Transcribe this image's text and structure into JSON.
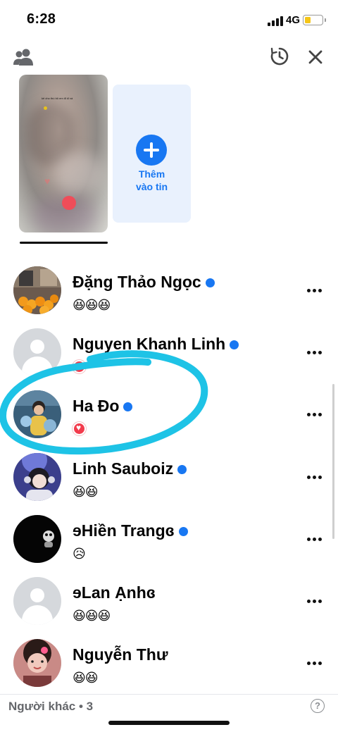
{
  "status_bar": {
    "time": "6:28",
    "network": "4G",
    "battery_level": 0.35
  },
  "header": {
    "left_icon": "friends-icon",
    "right_icons": [
      "history-icon",
      "close-icon"
    ]
  },
  "story": {
    "add_card_label_line1": "Thêm",
    "add_card_label_line2": "vào tin",
    "caption": "kẻ cho thú bỏ em đi kỉ vá"
  },
  "viewers": [
    {
      "name": "Đặng Thảo Ngọc",
      "online": true,
      "reaction": "😆😆😆",
      "reaction_type": "haha",
      "avatar": "photo-oranges"
    },
    {
      "name": "Nguyen Khanh Linh",
      "online": true,
      "reaction": "",
      "reaction_type": "love",
      "avatar": "default"
    },
    {
      "name": "Ha Đo",
      "online": true,
      "reaction": "",
      "reaction_type": "love",
      "avatar": "photo-child"
    },
    {
      "name": "Linh Sauboiz",
      "online": true,
      "reaction": "😆😆",
      "reaction_type": "haha",
      "avatar": "photo-girl-headphones"
    },
    {
      "name": "ɘHiền Trangɞ",
      "online": true,
      "reaction": "😥",
      "reaction_type": "sad",
      "avatar": "photo-dark"
    },
    {
      "name": "ɘLan Ạnhɞ",
      "online": false,
      "reaction": "😆😆😆",
      "reaction_type": "haha",
      "avatar": "default"
    },
    {
      "name": "Nguyễn Thư",
      "online": false,
      "reaction": "😆😆",
      "reaction_type": "haha",
      "avatar": "photo-girl-pink"
    }
  ],
  "footer": {
    "label": "Người khác • 3",
    "help": "?"
  },
  "colors": {
    "accent": "#1877f2",
    "annotation": "#1ec3e6",
    "heart": "#f23b4c"
  }
}
